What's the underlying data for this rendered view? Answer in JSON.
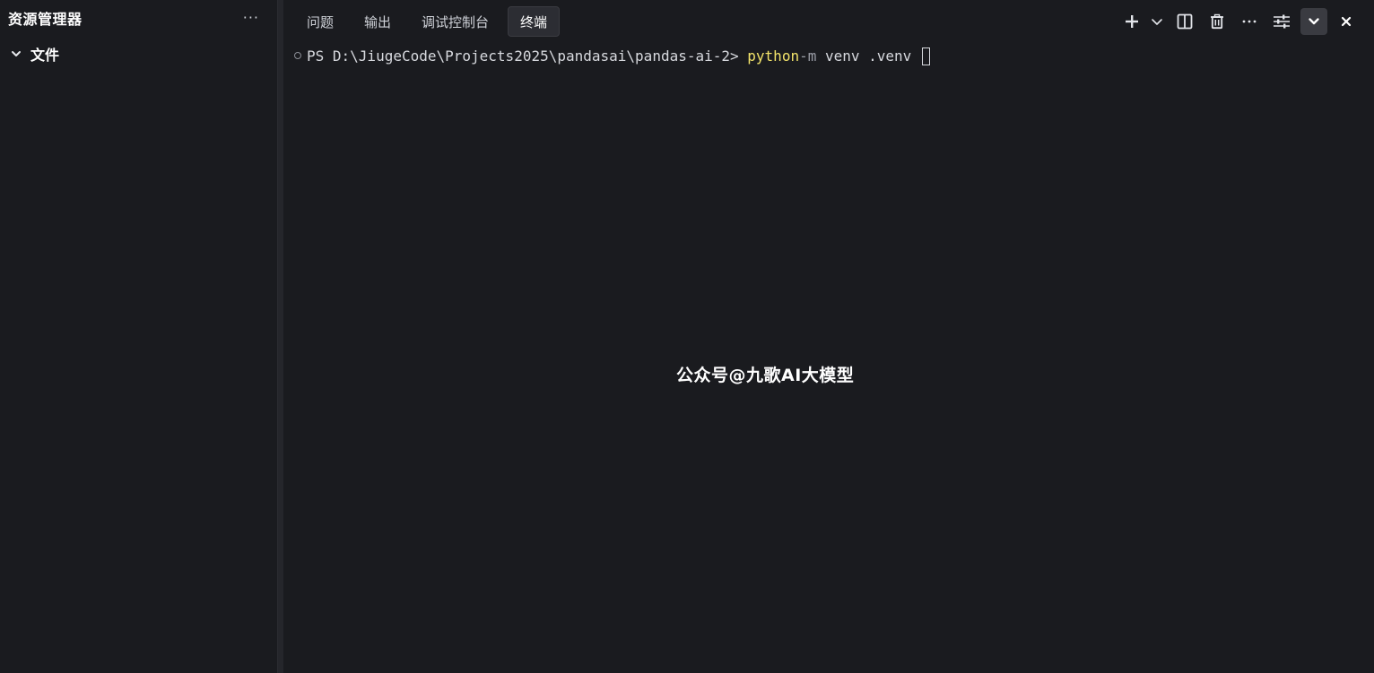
{
  "sidebar": {
    "title": "资源管理器",
    "more_label": "···",
    "section": {
      "label": "文件",
      "expanded_icon": "chevron-down-icon"
    }
  },
  "panel": {
    "tabs": [
      {
        "label": "问题",
        "active": false
      },
      {
        "label": "输出",
        "active": false
      },
      {
        "label": "调试控制台",
        "active": false
      },
      {
        "label": "终端",
        "active": true
      }
    ],
    "toolbar_icons": [
      "plus-icon",
      "chevron-down-icon",
      "split-icon",
      "trash-icon",
      "more-icon",
      "settings-sliders-icon",
      "collapse-chevron-icon",
      "close-icon"
    ]
  },
  "terminal": {
    "prompt": "PS D:\\JiugeCode\\Projects2025\\pandasai\\pandas-ai-2> ",
    "command": "python",
    "flag": "-m",
    "args": " venv .venv "
  },
  "watermark": {
    "text": "公众号@九歌AI大模型"
  },
  "colors": {
    "background": "#1a1b1f",
    "active_tab": "#2c2d33",
    "command_yellow": "#f2e36a"
  }
}
